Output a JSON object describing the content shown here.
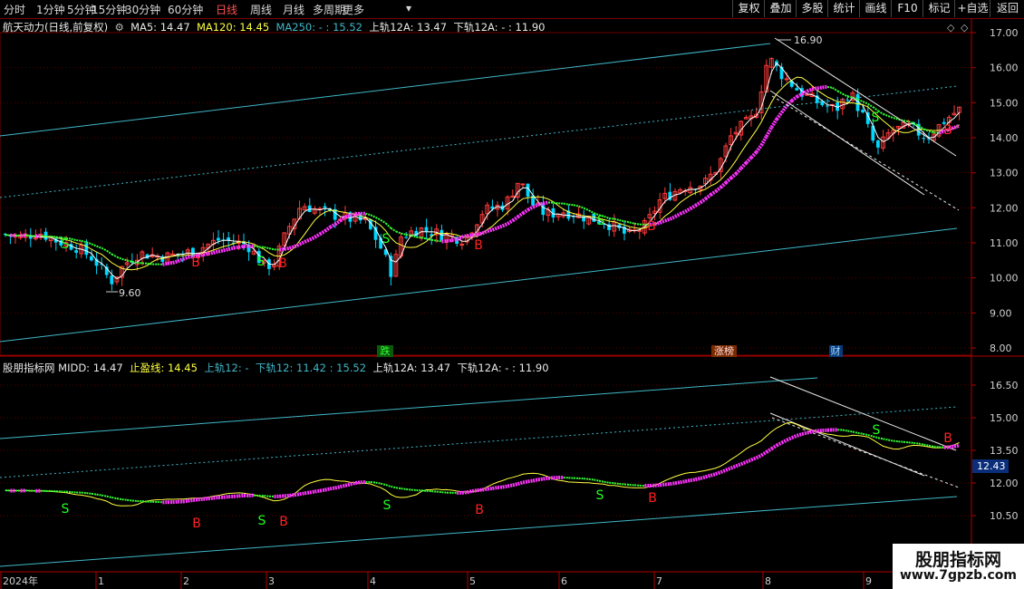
{
  "toolbar": {
    "periods": [
      "分时",
      "1分钟",
      "5分钟",
      "15分钟",
      "30分钟",
      "60分钟",
      "日线",
      "周线",
      "月线",
      "多周期",
      "更多"
    ],
    "active_period": "日线",
    "more_arrow": "▾",
    "buttons": [
      "复权",
      "叠加",
      "多股",
      "统计",
      "画线",
      "F10",
      "标记",
      "+自选",
      "返回"
    ]
  },
  "main_panel": {
    "title": "航天动力(日线,前复权)",
    "ma5": "MA5: 14.47",
    "ma120": "MA120: 14.45",
    "ma250": "MA250: -",
    "ma250_val": ": 15.52",
    "up12a": "上轨12A: 13.47",
    "down12a": "下轨12A: -",
    "down12a_val": ": 11.90",
    "peak_label": "16.90",
    "low_label": "9.60",
    "y_ticks": [
      "17.00",
      "16.00",
      "15.00",
      "14.00",
      "13.00",
      "12.00",
      "11.00",
      "10.00",
      "9.00",
      "8.00"
    ],
    "markers": [
      "跌",
      "涨榜",
      "财"
    ]
  },
  "sub_panel": {
    "title": "股朋指标网",
    "midd": "MIDD: 14.47",
    "stop": "止盈线: 14.45",
    "up12": "上轨12: -",
    "down12": "下轨12: 11.42",
    "down12_val": ": 15.52",
    "up12a": "上轨12A: 13.47",
    "down12a": "下轨12A: -",
    "down12a_val": ": 11.90",
    "y_ticks": [
      "16.50",
      "15.00",
      "13.50",
      "12.00",
      "10.50"
    ],
    "cursor_value": "12.43"
  },
  "xaxis": {
    "labels": [
      "2024年",
      "1",
      "2",
      "3",
      "4",
      "5",
      "6",
      "7",
      "8",
      "9"
    ]
  },
  "watermark": {
    "line1": "股朋指标网",
    "line2": "www.7gpzb.com"
  },
  "colors": {
    "up": "#ff3b3b",
    "down": "#00d8ff",
    "ma5": "#ffffff",
    "ma120": "#ffff40",
    "pink": "#ff33ff",
    "green": "#33ff33",
    "channel": "#3fb8c8"
  }
}
